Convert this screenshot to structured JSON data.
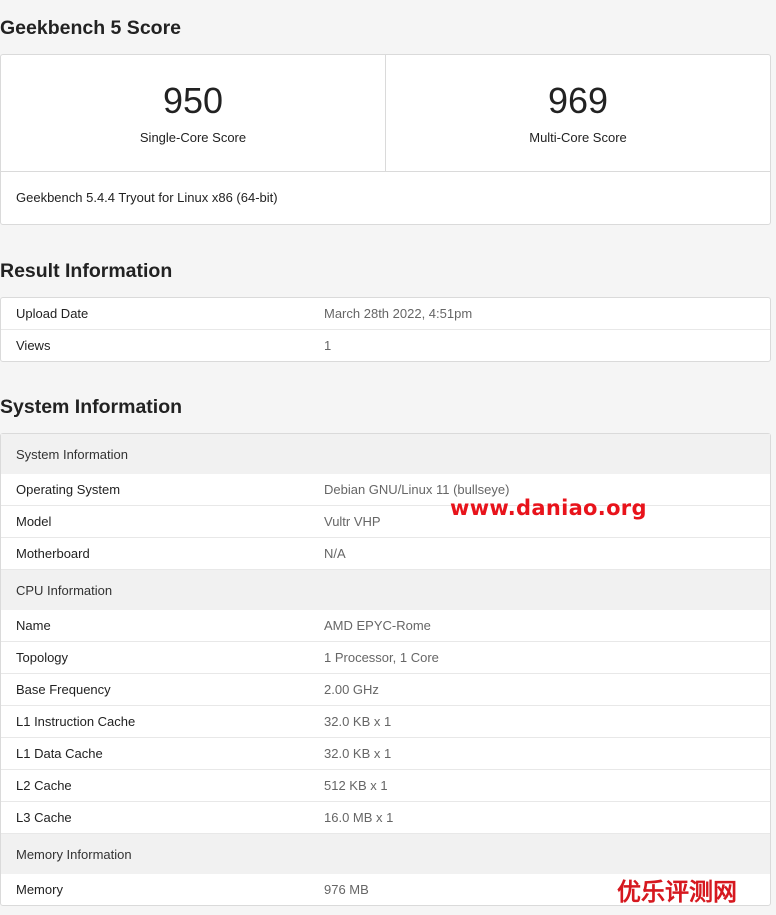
{
  "score_section": {
    "title": "Geekbench 5 Score",
    "single_core": {
      "value": "950",
      "label": "Single-Core Score"
    },
    "multi_core": {
      "value": "969",
      "label": "Multi-Core Score"
    },
    "version": "Geekbench 5.4.4 Tryout for Linux x86 (64-bit)"
  },
  "result_section": {
    "title": "Result Information",
    "rows": [
      {
        "key": "Upload Date",
        "value": "March 28th 2022, 4:51pm"
      },
      {
        "key": "Views",
        "value": "1"
      }
    ]
  },
  "system_section": {
    "title": "System Information",
    "groups": [
      {
        "heading": "System Information",
        "rows": [
          {
            "key": "Operating System",
            "value": "Debian GNU/Linux 11 (bullseye)"
          },
          {
            "key": "Model",
            "value": "Vultr VHP"
          },
          {
            "key": "Motherboard",
            "value": "N/A"
          }
        ]
      },
      {
        "heading": "CPU Information",
        "rows": [
          {
            "key": "Name",
            "value": "AMD EPYC-Rome"
          },
          {
            "key": "Topology",
            "value": "1 Processor, 1 Core"
          },
          {
            "key": "Base Frequency",
            "value": "2.00 GHz"
          },
          {
            "key": "L1 Instruction Cache",
            "value": "32.0 KB x 1"
          },
          {
            "key": "L1 Data Cache",
            "value": "32.0 KB x 1"
          },
          {
            "key": "L2 Cache",
            "value": "512 KB x 1"
          },
          {
            "key": "L3 Cache",
            "value": "16.0 MB x 1"
          }
        ]
      },
      {
        "heading": "Memory Information",
        "rows": [
          {
            "key": "Memory",
            "value": "976 MB"
          }
        ]
      }
    ]
  },
  "watermarks": {
    "site_url": "www.daniao.org",
    "site_logo": "优乐评测网"
  },
  "colors": {
    "watermark_red": "#e8131b"
  }
}
